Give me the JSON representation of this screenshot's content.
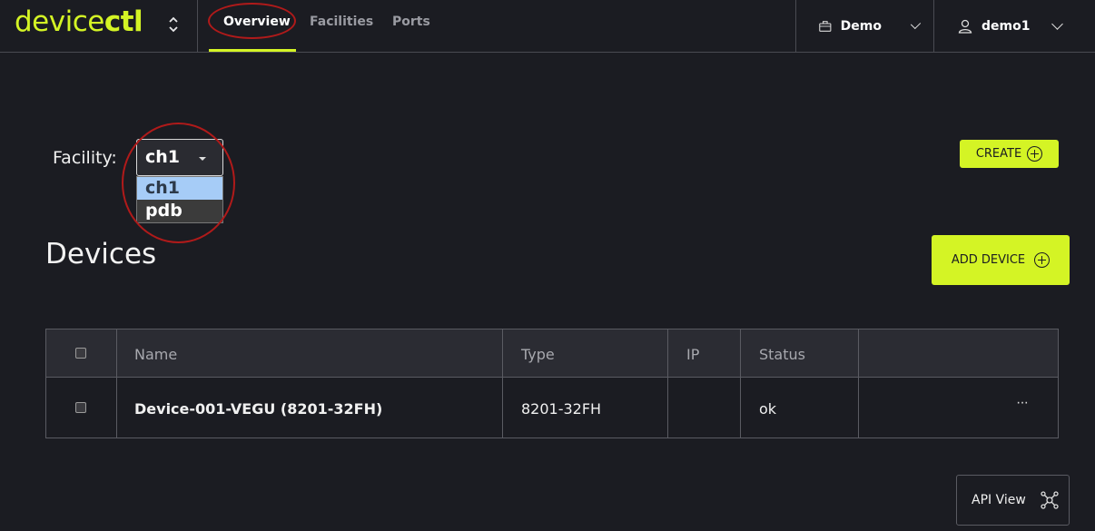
{
  "app": {
    "logo_light": "device",
    "logo_bold": "ctl"
  },
  "nav": {
    "tabs": [
      {
        "label": "Overview",
        "active": true
      },
      {
        "label": "Facilities",
        "active": false
      },
      {
        "label": "Ports",
        "active": false
      }
    ]
  },
  "header": {
    "org_label": "Demo",
    "user_label": "demo1"
  },
  "facility": {
    "label": "Facility:",
    "selected": "ch1",
    "options": [
      "ch1",
      "pdb"
    ]
  },
  "buttons": {
    "create": "CREATE",
    "add_device": "ADD DEVICE",
    "api_view": "API View"
  },
  "devices": {
    "title": "Devices",
    "columns": [
      "Name",
      "Type",
      "IP",
      "Status"
    ],
    "rows": [
      {
        "name": "Device-001-VEGU (8201-32FH)",
        "type": "8201-32FH",
        "ip": "",
        "status": "ok",
        "actions": "···"
      }
    ]
  },
  "colors": {
    "accent": "#d4f425",
    "background": "#1b1c22",
    "annotation": "#b01a1a"
  }
}
